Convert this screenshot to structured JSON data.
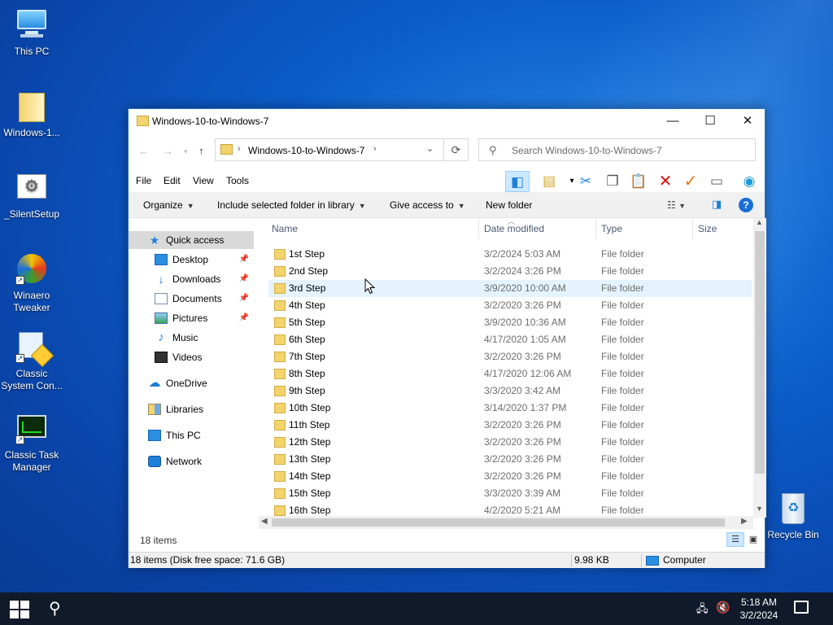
{
  "desktop": {
    "icons": [
      {
        "label": "This PC"
      },
      {
        "label": "Windows-1..."
      },
      {
        "label": "_SilentSetup"
      },
      {
        "label": "Winaero Tweaker"
      },
      {
        "label": "Classic System Con..."
      },
      {
        "label": "Classic Task Manager"
      },
      {
        "label": "Recycle Bin"
      }
    ]
  },
  "window": {
    "title": "Windows-10-to-Windows-7",
    "controls": {
      "minimize": "—",
      "maximize": "☐",
      "close": "✕"
    },
    "address": {
      "crumb": "Windows-10-to-Windows-7"
    },
    "search": {
      "placeholder": "Search Windows-10-to-Windows-7"
    },
    "menu": [
      "File",
      "Edit",
      "View",
      "Tools"
    ],
    "commands": {
      "organize": "Organize",
      "include": "Include selected folder in library",
      "give_access": "Give access to",
      "new_folder": "New folder"
    },
    "columns": {
      "name": "Name",
      "date": "Date modified",
      "type": "Type",
      "size": "Size"
    },
    "nav": {
      "quick_access": "Quick access",
      "desktop": "Desktop",
      "downloads": "Downloads",
      "documents": "Documents",
      "pictures": "Pictures",
      "music": "Music",
      "videos": "Videos",
      "onedrive": "OneDrive",
      "libraries": "Libraries",
      "this_pc": "This PC",
      "network": "Network"
    },
    "files": [
      {
        "name": "1st Step",
        "date": "3/2/2024 5:03 AM",
        "type": "File folder"
      },
      {
        "name": "2nd Step",
        "date": "3/2/2024 3:26 PM",
        "type": "File folder"
      },
      {
        "name": "3rd Step",
        "date": "3/9/2020 10:00 AM",
        "type": "File folder"
      },
      {
        "name": "4th Step",
        "date": "3/2/2020 3:26 PM",
        "type": "File folder"
      },
      {
        "name": "5th Step",
        "date": "3/9/2020 10:36 AM",
        "type": "File folder"
      },
      {
        "name": "6th Step",
        "date": "4/17/2020 1:05 AM",
        "type": "File folder"
      },
      {
        "name": "7th Step",
        "date": "3/2/2020 3:26 PM",
        "type": "File folder"
      },
      {
        "name": "8th Step",
        "date": "4/17/2020 12:06 AM",
        "type": "File folder"
      },
      {
        "name": "9th Step",
        "date": "3/3/2020 3:42 AM",
        "type": "File folder"
      },
      {
        "name": "10th Step",
        "date": "3/14/2020 1:37 PM",
        "type": "File folder"
      },
      {
        "name": "11th Step",
        "date": "3/2/2020 3:26 PM",
        "type": "File folder"
      },
      {
        "name": "12th Step",
        "date": "3/2/2020 3:26 PM",
        "type": "File folder"
      },
      {
        "name": "13th Step",
        "date": "3/2/2020 3:26 PM",
        "type": "File folder"
      },
      {
        "name": "14th Step",
        "date": "3/2/2020 3:26 PM",
        "type": "File folder"
      },
      {
        "name": "15th Step",
        "date": "3/3/2020 3:39 AM",
        "type": "File folder"
      },
      {
        "name": "16th Step",
        "date": "4/2/2020 5:21 AM",
        "type": "File folder"
      }
    ],
    "item_count": "18 items",
    "status": {
      "left": "18 items (Disk free space: 71.6 GB)",
      "size": "9.98 KB",
      "location": "Computer"
    }
  },
  "taskbar": {
    "time": "5:18 AM",
    "date": "3/2/2024"
  },
  "colors": {
    "accent": "#1e7fd8",
    "selection": "#cce8ff",
    "hover": "#e5f3ff",
    "folder": "#f3d36b"
  }
}
